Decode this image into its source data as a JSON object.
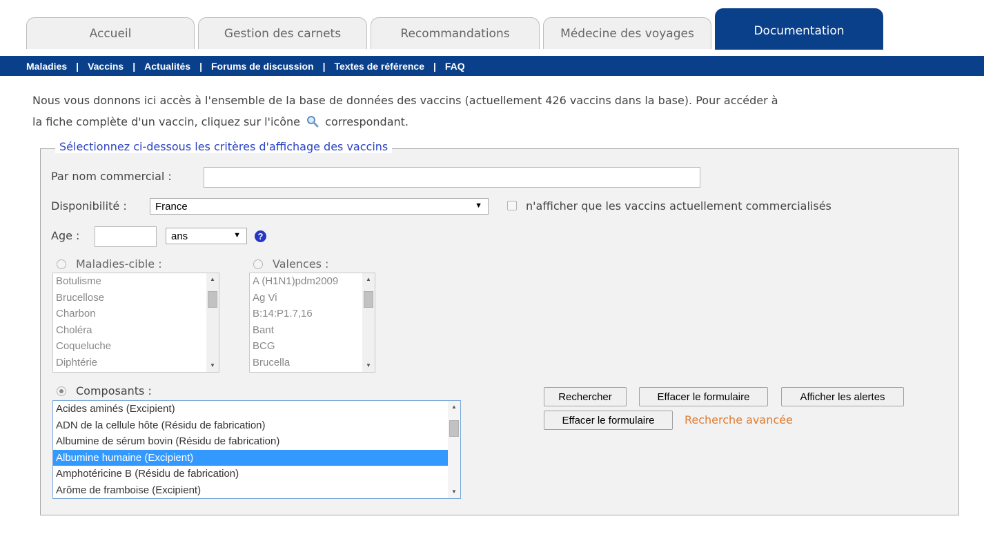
{
  "tabs": [
    {
      "label": "Accueil"
    },
    {
      "label": "Gestion des carnets"
    },
    {
      "label": "Recommandations"
    },
    {
      "label": "Médecine des voyages"
    },
    {
      "label": "Documentation"
    }
  ],
  "subnav": {
    "items": [
      "Maladies",
      "Vaccins",
      "Actualités",
      "Forums de discussion",
      "Textes de référence",
      "FAQ"
    ],
    "separator": "|"
  },
  "intro": {
    "line1": "Nous vous donnons ici accès à l'ensemble de la base de données des vaccins (actuellement 426 vaccins dans la base). Pour accéder à",
    "line2_before": "la fiche complète d'un vaccin, cliquez sur l'icône",
    "line2_after": "correspondant."
  },
  "form": {
    "legend": "Sélectionnez ci-dessous les critères d'affichage des vaccins",
    "nom_label": "Par nom commercial :",
    "nom_value": "",
    "dispo_label": "Disponibilité :",
    "dispo_value": "France",
    "commercialises_label": "n'afficher que les vaccins actuellement commercialisés",
    "age_label": "Age :",
    "age_value": "",
    "age_unit": "ans",
    "help": "?",
    "maladies_label": "Maladies-cible :",
    "maladies": [
      "Botulisme",
      "Brucellose",
      "Charbon",
      "Choléra",
      "Coqueluche",
      "Diphtérie"
    ],
    "valences_label": "Valences :",
    "valences": [
      "A (H1N1)pdm2009",
      "Ag Vi",
      "B:14:P1.7,16",
      "Bant",
      "BCG",
      "Brucella"
    ],
    "composants_label": "Composants :",
    "composants": [
      "Acides aminés (Excipient)",
      "ADN de la cellule hôte (Résidu de fabrication)",
      "Albumine de sérum bovin (Résidu de fabrication)",
      "Albumine humaine (Excipient)",
      "Amphotéricine B (Résidu de fabrication)",
      "Arôme de framboise (Excipient)"
    ],
    "selected_composant": "Albumine humaine (Excipient)"
  },
  "buttons": {
    "rechercher": "Rechercher",
    "effacer1": "Effacer le formulaire",
    "alertes": "Afficher les alertes",
    "effacer2": "Effacer le formulaire",
    "avancee": "Recherche avancée"
  },
  "colors": {
    "nav_blue": "#0a3f8a",
    "legend_blue": "#2a43c4",
    "link_orange": "#e07b30",
    "selection": "#3399ff"
  }
}
